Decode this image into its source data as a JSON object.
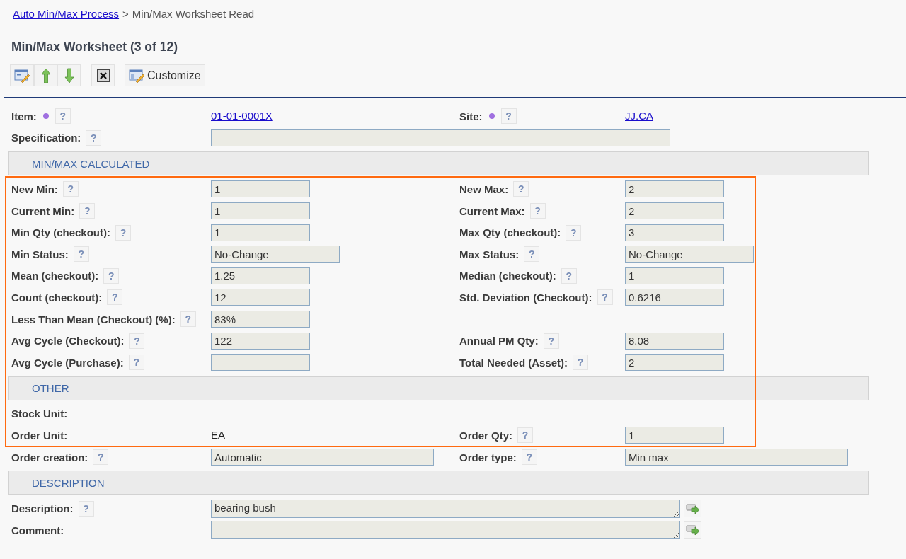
{
  "breadcrumb": {
    "link": "Auto Min/Max Process",
    "separator": ">",
    "current": "Min/Max Worksheet Read"
  },
  "title": "Min/Max Worksheet (3 of 12)",
  "toolbar": [
    {
      "kind": "edit"
    },
    {
      "kind": "up"
    },
    {
      "kind": "down"
    },
    {
      "kind": "close"
    },
    {
      "kind": "customize",
      "label": "Customize"
    }
  ],
  "blocks": [
    {
      "kind": "row",
      "left": {
        "label": "Item:",
        "required": true,
        "help": "?",
        "kind": "link",
        "value": "01-01-0001X"
      },
      "right": {
        "label": "Site:",
        "required": true,
        "help": "?",
        "kind": "link",
        "value": "JJ.CA"
      }
    },
    {
      "kind": "row",
      "left": {
        "label": "Specification:",
        "help": "?",
        "kind": "wide-field"
      }
    },
    {
      "kind": "section",
      "title": "MIN/MAX CALCULATED"
    },
    {
      "kind": "highlight",
      "blocks": [
        {
          "kind": "row",
          "left": {
            "label": "New Min:",
            "help": "?",
            "kind": "short-field",
            "value": "1"
          },
          "right": {
            "label": "New Max:",
            "help": "?",
            "kind": "short-field",
            "value": "2"
          }
        },
        {
          "kind": "row",
          "left": {
            "label": "Current Min:",
            "help": "?",
            "kind": "short-field",
            "value": "1"
          },
          "right": {
            "label": "Current Max:",
            "help": "?",
            "kind": "short-field",
            "value": "2"
          }
        },
        {
          "kind": "row",
          "left": {
            "label": "Min Qty (checkout):",
            "help": "?",
            "kind": "short-field",
            "value": "1"
          },
          "right": {
            "label": "Max Qty (checkout):",
            "help": "?",
            "kind": "short-field",
            "value": "3"
          }
        },
        {
          "kind": "row",
          "left": {
            "label": "Min Status:",
            "help": "?",
            "kind": "medium-field",
            "value": "No-Change"
          },
          "right": {
            "label": "Max Status:",
            "help": "?",
            "kind": "medium-field",
            "value": "No-Change"
          }
        },
        {
          "kind": "row",
          "left": {
            "label": "Mean (checkout):",
            "help": "?",
            "kind": "short-field",
            "value": "1.25"
          },
          "right": {
            "label": "Median (checkout):",
            "help": "?",
            "kind": "short-field",
            "value": "1"
          }
        },
        {
          "kind": "row",
          "left": {
            "label": "Count (checkout):",
            "help": "?",
            "kind": "short-field",
            "value": "12"
          },
          "right": {
            "label": "Std. Deviation (Checkout):",
            "help": "?",
            "kind": "short-field",
            "value": "0.6216"
          }
        },
        {
          "kind": "row",
          "left": {
            "label": "Less Than Mean (Checkout) (%):",
            "help": "?",
            "kind": "short-field",
            "value": "83%"
          }
        },
        {
          "kind": "row",
          "left": {
            "label": "Avg Cycle (Checkout):",
            "help": "?",
            "kind": "short-field",
            "value": "122"
          },
          "right": {
            "label": "Annual PM Qty:",
            "help": "?",
            "kind": "short-field",
            "value": "8.08"
          }
        },
        {
          "kind": "row",
          "left": {
            "label": "Avg Cycle (Purchase):",
            "help": "?",
            "kind": "short-field"
          },
          "right": {
            "label": "Total Needed (Asset):",
            "help": "?",
            "kind": "short-field",
            "value": "2"
          }
        },
        {
          "kind": "section",
          "title": "OTHER"
        },
        {
          "kind": "row",
          "left": {
            "label": "Stock Unit:",
            "kind": "text",
            "value": "—"
          }
        },
        {
          "kind": "row",
          "left": {
            "label": "Order Unit:",
            "kind": "text",
            "value": "EA"
          },
          "right": {
            "label": "Order Qty:",
            "help": "?",
            "kind": "short-field",
            "value": "1"
          }
        }
      ]
    },
    {
      "kind": "row",
      "left": {
        "label": "Order creation:",
        "help": "?",
        "kind": "long-field",
        "value": "Automatic"
      },
      "right": {
        "label": "Order type:",
        "help": "?",
        "kind": "long-field",
        "value": "Min max"
      }
    },
    {
      "kind": "section",
      "title": "DESCRIPTION"
    },
    {
      "kind": "row",
      "left": {
        "label": "Description:",
        "help": "?",
        "kind": "textarea",
        "value": "bearing bush"
      }
    },
    {
      "kind": "row",
      "left": {
        "label": "Comment:",
        "kind": "textarea"
      }
    }
  ]
}
